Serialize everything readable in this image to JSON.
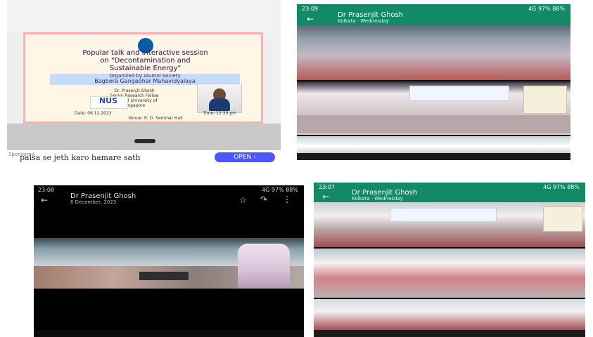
{
  "top_left": {
    "poster": {
      "headline_lines": [
        "Popular talk and interactive session",
        "on \"Decontamination and",
        "Sustainable Energy\""
      ],
      "organized_by": "Organized by Alumni Society",
      "college": "Bagbera Gangadhar Mahavidyalaya",
      "speaker_lines": [
        "Dr. Prasenjit Ghosh",
        "Senior Research Fellow",
        "National University of",
        "Singapore"
      ],
      "nus": "NUS",
      "footer_left": "Date: 06.12.2023",
      "footer_mid": "Time: 12:30 pm",
      "footer_venue": "Venue: R. D. Seminar Hall"
    },
    "ad": {
      "left": "Sponsored",
      "text": "paisa se jeth karo hamare sath",
      "button": "OPEN  ›"
    }
  },
  "top_right": {
    "status_time": "23:09",
    "status_right": "4G 97% 88%",
    "back": "←",
    "name": "Dr Prasenjit Ghosh",
    "subtitle": "Kolkata · Wednesday"
  },
  "bottom_left": {
    "status_time": "23:08",
    "status_right": "4G 97% 88%",
    "back": "←",
    "name": "Dr Prasenjit Ghosh",
    "date": "6 December, 2023",
    "star": "☆",
    "share": "↷",
    "more": "⋮"
  },
  "bottom_right": {
    "status_time": "23:07",
    "status_right": "4G 97% 88%",
    "back": "←",
    "name": "Dr Prasenjit Ghosh",
    "subtitle": "Kolkata · Wednesday"
  },
  "colors": {
    "whatsapp_green": "#138a66",
    "poster_bg": "#fff6e5",
    "poster_border": "#ffb1b1",
    "ad_bar": "#ffffff"
  }
}
